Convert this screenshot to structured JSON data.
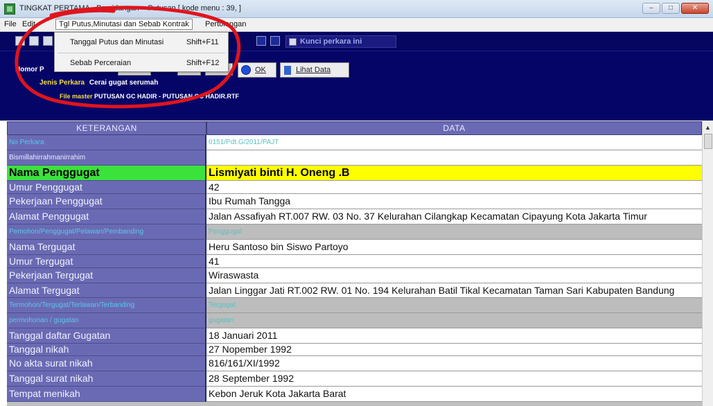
{
  "window": {
    "title": "TINGKAT PERTAMA - Persidangan > Putusan  [ kode menu : 39, ]"
  },
  "menubar": {
    "items": [
      "File",
      "Edit",
      "Tgl Putus,Minutasi dan Sebab Kontrak",
      "Pertolongan"
    ]
  },
  "dropdown": {
    "items": [
      {
        "label": "Tanggal Putus dan Minutasi",
        "shortcut": "Shift+F11"
      },
      {
        "label": "Sebab Perceraian",
        "shortcut": "Shift+F12"
      }
    ]
  },
  "toolbar": {
    "kunci_label": "Kunci perkara ini"
  },
  "header": {
    "nomor_label": "Nomor P",
    "ok_label": "OK",
    "lihat_label": "Lihat Data",
    "jenis_key": "Jenis Perkara",
    "jenis_value": "Cerai gugat serumah",
    "file_key": "File master",
    "file_value": "PUTUSAN GC HADIR - PUTUSAN GC HADIR.RTF"
  },
  "table": {
    "headers": [
      "KETERANGAN",
      "DATA"
    ],
    "rows": [
      {
        "key": "No Perkara",
        "value": "0151/Pdt.G/2011/PAJT"
      },
      {
        "key": "Bismillahirrahmanirrahim",
        "value": ""
      },
      {
        "key": "Nama Penggugat",
        "value": "Lismiyati binti H. Oneng .B"
      },
      {
        "key": "Umur Penggugat",
        "value": "42"
      },
      {
        "key": "Pekerjaan Penggugat",
        "value": "Ibu Rumah Tangga"
      },
      {
        "key": "Alamat Penggugat",
        "value": "Jalan Assafiyah  RT.007 RW. 03 No. 37  Kelurahan Cilangkap  Kecamatan Cipayung Kota Jakarta Timur"
      },
      {
        "key": "Pemohon/Penggugat/Pelawan/Pembanding",
        "value": "Penggugat"
      },
      {
        "key": "Nama Tergugat",
        "value": "Heru Santoso bin Siswo Partoyo"
      },
      {
        "key": "Umur Tergugat",
        "value": "41"
      },
      {
        "key": "Pekerjaan Tergugat",
        "value": "Wiraswasta"
      },
      {
        "key": "Alamat Tergugat",
        "value": "Jalan Linggar Jati RT.002 RW. 01 No. 194 Kelurahan Batil Tikal Kecamatan Taman Sari Kabupaten Bandung"
      },
      {
        "key": "Termohon/Tergugat/Terlawan/Terbanding",
        "value": "Tergugat"
      },
      {
        "key": "permohonan / gugatan",
        "value": "gugatan"
      },
      {
        "key": "Tanggal daftar Gugatan",
        "value": "18 Januari 2011"
      },
      {
        "key": "Tanggal nikah",
        "value": "27 Nopember 1992"
      },
      {
        "key": "No akta surat nikah",
        "value": "816/161/XI/1992"
      },
      {
        "key": "Tanggal surat nikah",
        "value": "28 September 1992"
      },
      {
        "key": "Tempat menikah",
        "value": "Kebon Jeruk  Kota Jakarta Barat"
      }
    ]
  },
  "colors": {
    "header_bg": "#050568",
    "key_bg": "#6a6ab4",
    "highlight_key": "#3ce23c",
    "highlight_value": "#ffff00",
    "annotation": "#e0141c"
  }
}
